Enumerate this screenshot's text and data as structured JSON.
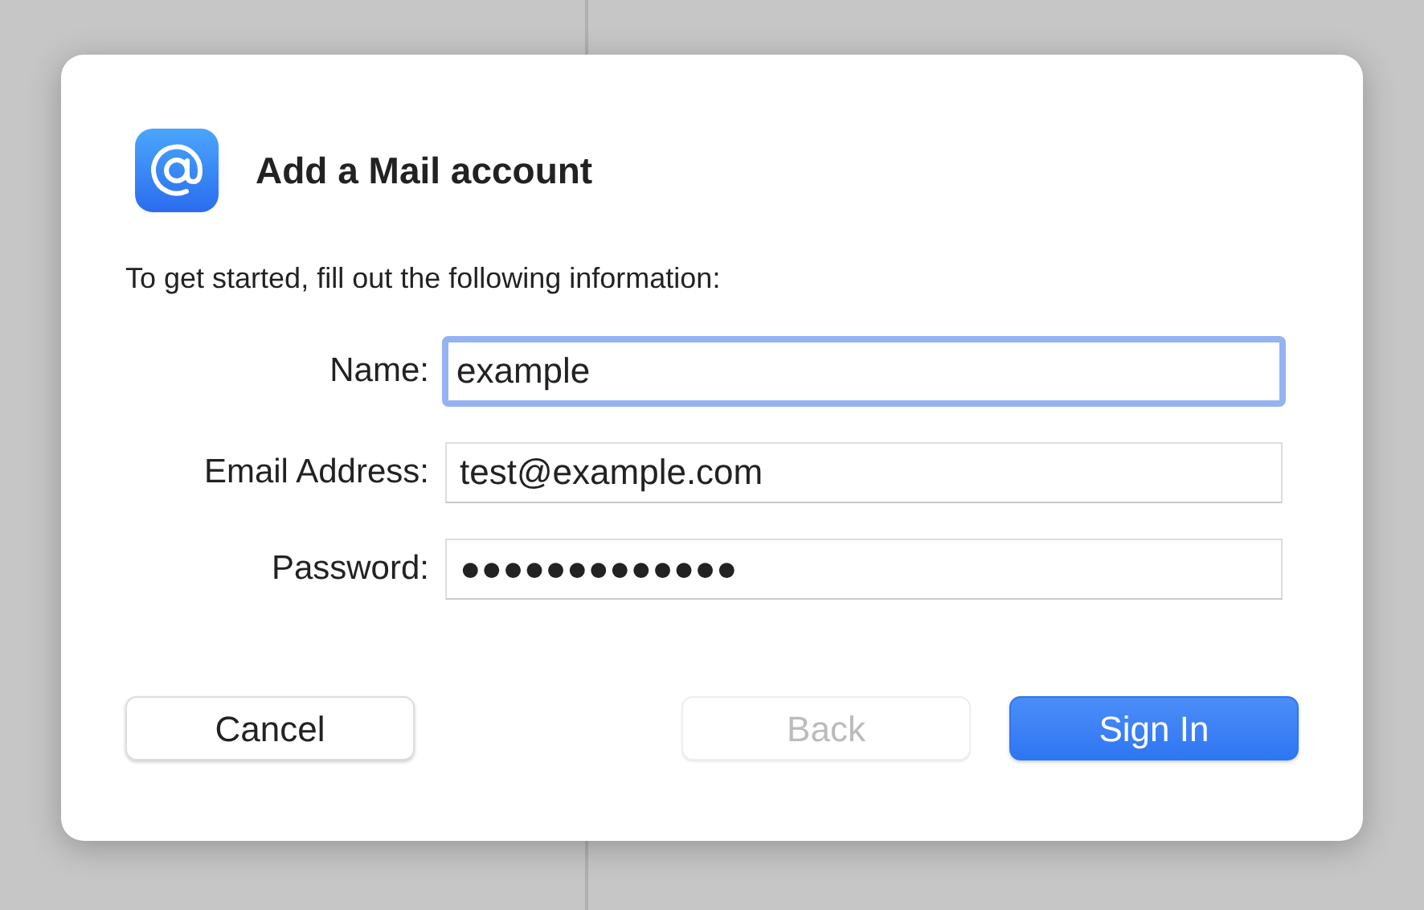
{
  "dialog": {
    "title": "Add a Mail account",
    "instructions": "To get started, fill out the following information:",
    "fields": [
      {
        "label": "Name:",
        "value": "example",
        "focused": true
      },
      {
        "label": "Email Address:",
        "value": "test@example.com",
        "focused": false
      },
      {
        "label": "Password:",
        "value": "●●●●●●●●●●●●●",
        "focused": false
      }
    ],
    "buttons": [
      {
        "label": "Cancel",
        "kind": "secondary",
        "disabled": false
      },
      {
        "label": "Back",
        "kind": "secondary",
        "disabled": true
      },
      {
        "label": "Sign In",
        "kind": "primary",
        "disabled": false
      }
    ]
  }
}
